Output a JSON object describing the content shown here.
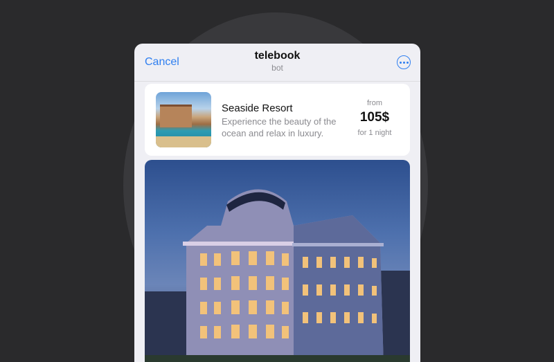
{
  "nav": {
    "cancel_label": "Cancel",
    "title": "telebook",
    "subtitle": "bot",
    "more_icon": "ellipsis-circle-icon"
  },
  "listing": {
    "name": "Seaside Resort",
    "description": "Experience the beauty of the ocean and relax in luxury.",
    "price_prefix": "from",
    "price": "105$",
    "price_suffix": "for 1 night"
  },
  "colors": {
    "accent": "#2f7ff0",
    "background": "#2a2a2c",
    "sheet": "#efeff4"
  }
}
